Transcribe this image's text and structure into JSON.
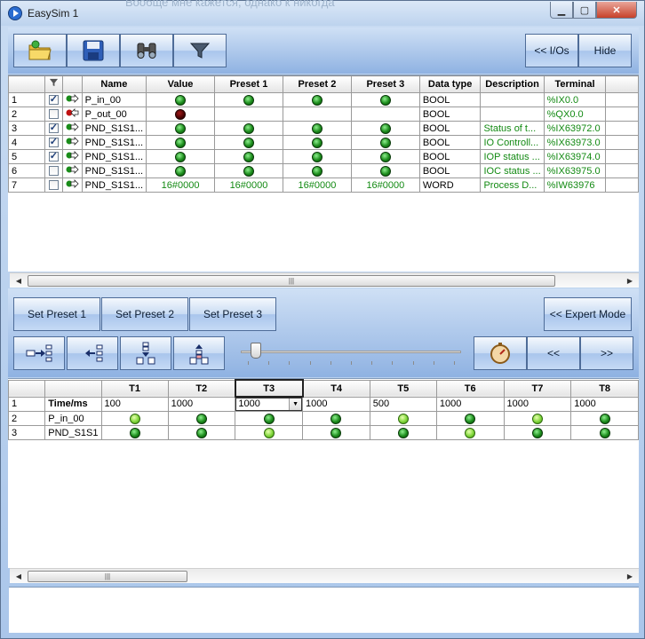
{
  "window": {
    "title": "EasySim 1",
    "bg_text": "Вообще мне кажется, однако к никогда"
  },
  "titlebar": {
    "min": "▁",
    "max": "▢",
    "close": "✕"
  },
  "toolbar": {
    "ios_label": "<< I/Os",
    "hide_label": "Hide"
  },
  "io_table": {
    "headers": [
      "",
      "",
      "",
      "Name",
      "Value",
      "Preset 1",
      "Preset 2",
      "Preset 3",
      "Data type",
      "Description",
      "Terminal"
    ],
    "rows": [
      {
        "num": "1",
        "checked": true,
        "dir": "in",
        "name": "P_in_00",
        "value": "led",
        "p1": "led",
        "p2": "led",
        "p3": "led",
        "type": "BOOL",
        "desc": "",
        "terminal": "%IX0.0"
      },
      {
        "num": "2",
        "checked": false,
        "dir": "out",
        "name": "P_out_00",
        "value": "led-red",
        "p1": "",
        "p2": "",
        "p3": "",
        "type": "BOOL",
        "desc": "",
        "terminal": "%QX0.0"
      },
      {
        "num": "3",
        "checked": true,
        "dir": "in",
        "name": "PND_S1S1...",
        "value": "led",
        "p1": "led",
        "p2": "led",
        "p3": "led",
        "type": "BOOL",
        "desc": "Status of t...",
        "terminal": "%IX63972.0"
      },
      {
        "num": "4",
        "checked": true,
        "dir": "in",
        "name": "PND_S1S1...",
        "value": "led",
        "p1": "led",
        "p2": "led",
        "p3": "led",
        "type": "BOOL",
        "desc": "IO Controll...",
        "terminal": "%IX63973.0"
      },
      {
        "num": "5",
        "checked": true,
        "dir": "in",
        "name": "PND_S1S1...",
        "value": "led",
        "p1": "led",
        "p2": "led",
        "p3": "led",
        "type": "BOOL",
        "desc": "IOP status ...",
        "terminal": "%IX63974.0"
      },
      {
        "num": "6",
        "checked": false,
        "dir": "in",
        "name": "PND_S1S1...",
        "value": "led",
        "p1": "led",
        "p2": "led",
        "p3": "led",
        "type": "BOOL",
        "desc": "IOC status ...",
        "terminal": "%IX63975.0"
      },
      {
        "num": "7",
        "checked": false,
        "dir": "in",
        "name": "PND_S1S1...",
        "value": "16#0000",
        "p1": "16#0000",
        "p2": "16#0000",
        "p3": "16#0000",
        "type": "WORD",
        "desc": "Process D...",
        "terminal": "%IW63976"
      }
    ]
  },
  "presets": {
    "p1": "Set Preset 1",
    "p2": "Set Preset 2",
    "p3": "Set Preset 3",
    "expert": "<< Expert Mode"
  },
  "nav": {
    "prev": "<<",
    "next": ">>"
  },
  "slider": {
    "position": 0.07,
    "ticks": 11
  },
  "timeline": {
    "headers": [
      "",
      "",
      "T1",
      "T2",
      "T3",
      "T4",
      "T5",
      "T6",
      "T7",
      "T8"
    ],
    "row1": {
      "num": "1",
      "label": "Time/ms",
      "values": [
        "100",
        "1000",
        "1000",
        "1000",
        "500",
        "1000",
        "1000",
        "1000"
      ]
    },
    "row2": {
      "num": "2",
      "label": "P_in_00",
      "leds": [
        "led-light",
        "led",
        "led",
        "led",
        "led-light",
        "led",
        "led-light",
        "led"
      ]
    },
    "row3": {
      "num": "3",
      "label": "PND_S1S1",
      "leds": [
        "led",
        "led",
        "led-light",
        "led",
        "led",
        "led-light",
        "led",
        "led"
      ]
    }
  },
  "scroll_grip": "|||"
}
